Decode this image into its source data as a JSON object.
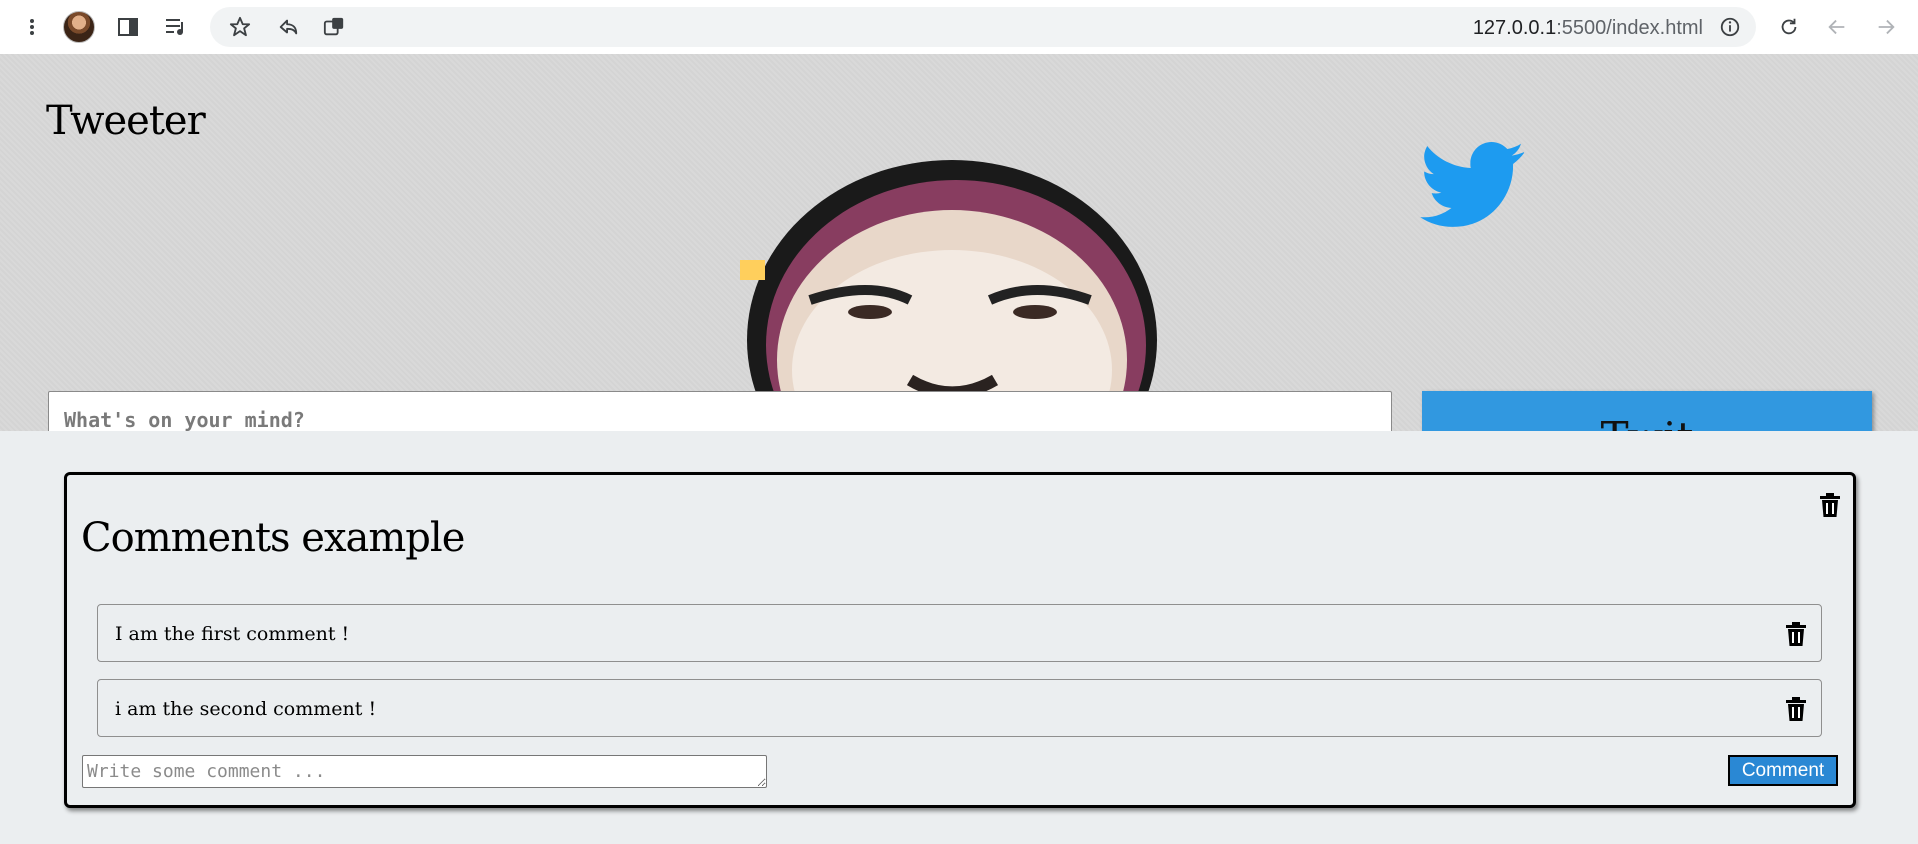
{
  "browser": {
    "url_host": "127.0.0.1",
    "url_rest": ":5500/index.html",
    "icons": [
      "more-vert-icon",
      "profile-avatar",
      "side-panel-icon",
      "reading-list-icon",
      "star-icon",
      "share-icon",
      "install-app-icon",
      "info-icon",
      "reload-icon",
      "back-icon",
      "forward-icon"
    ]
  },
  "header": {
    "title": "Tweeter",
    "input_placeholder": "What's on your mind?",
    "button_label": "Twit",
    "bird_color": "#1d9bf0",
    "button_color": "#3198e0"
  },
  "post": {
    "title": "Comments example",
    "comments": [
      {
        "text": "I am the first comment !"
      },
      {
        "text": "i am the second comment !"
      }
    ],
    "comment_placeholder": "Write some comment ...",
    "comment_button": "Comment"
  }
}
